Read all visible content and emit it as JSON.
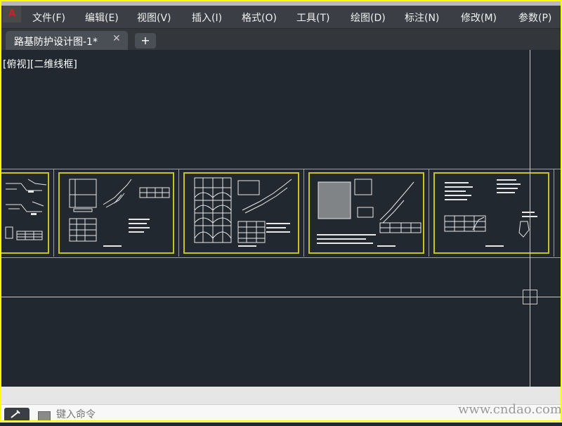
{
  "menu": {
    "app_icon_glyph": "A",
    "items": [
      "文件(F)",
      "编辑(E)",
      "视图(V)",
      "插入(I)",
      "格式(O)",
      "工具(T)",
      "绘图(D)",
      "标注(N)",
      "修改(M)",
      "参数(P)"
    ]
  },
  "tabs": {
    "active_label": "路基防护设计图-1*",
    "close_glyph": "✕",
    "add_glyph": "+"
  },
  "viewport": {
    "view_label": "[俯视][二维线框]"
  },
  "command": {
    "placeholder": "键入命令"
  },
  "watermark": "www.cndao.com",
  "colors": {
    "sheet_border": "#c8c31c",
    "frame": "#ffff00",
    "background": "#212830"
  }
}
